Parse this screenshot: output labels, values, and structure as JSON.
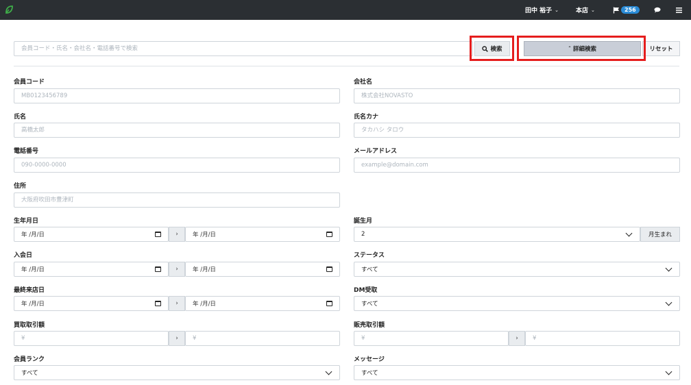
{
  "navbar": {
    "user": "田中 裕子",
    "store": "本店",
    "notification_count": "256"
  },
  "search": {
    "placeholder": "会員コード・氏名・会社名・電話番号で検索",
    "search_button": "検索",
    "advanced_button": "詳細検索",
    "reset_button": "リセット"
  },
  "form": {
    "member_code": {
      "label": "会員コード",
      "placeholder": "MB0123456789"
    },
    "company": {
      "label": "会社名",
      "placeholder": "株式会社NOVASTO"
    },
    "name": {
      "label": "氏名",
      "placeholder": "高橋太郎"
    },
    "name_kana": {
      "label": "氏名カナ",
      "placeholder": "タカハシ タロウ"
    },
    "phone": {
      "label": "電話番号",
      "placeholder": "090-0000-0000"
    },
    "email": {
      "label": "メールアドレス",
      "placeholder": "example@domain.com"
    },
    "address": {
      "label": "住所",
      "placeholder": "大阪府吹田市豊津町"
    },
    "birthdate": {
      "label": "生年月日",
      "placeholder": "年 /月/日"
    },
    "birth_month": {
      "label": "誕生月",
      "value": "2",
      "suffix": "月生まれ"
    },
    "join_date": {
      "label": "入会日",
      "placeholder": "年 /月/日"
    },
    "status": {
      "label": "ステータス",
      "value": "すべて"
    },
    "last_visit": {
      "label": "最終来店日",
      "placeholder": "年 /月/日"
    },
    "dm": {
      "label": "DM受取",
      "value": "すべて"
    },
    "buy_amount": {
      "label": "買取取引額",
      "placeholder": "¥"
    },
    "sell_amount": {
      "label": "販売取引額",
      "placeholder": "¥"
    },
    "rank": {
      "label": "会員ランク",
      "value": "すべて"
    },
    "message": {
      "label": "メッセージ",
      "value": "すべて"
    }
  },
  "range_separator": "›",
  "colors": {
    "navbar": "#2b2f33",
    "badge": "#2a8bd6",
    "highlight": "#e51d1d",
    "logo": "#3fae49"
  }
}
